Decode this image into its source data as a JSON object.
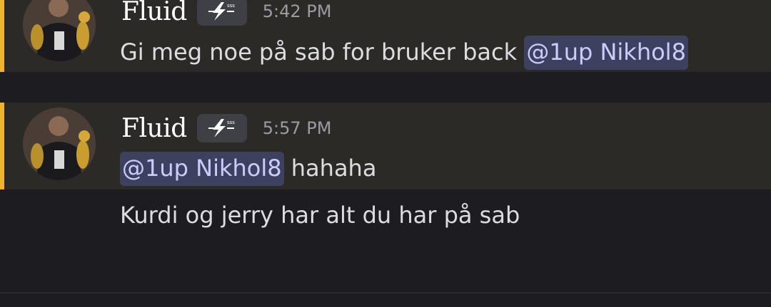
{
  "messages": [
    {
      "username": "Fluid",
      "timestamp": "5:42 PM",
      "badge_icon": "lightning-icon",
      "lines": [
        {
          "text": "Gi meg noe på sab for bruker back ",
          "mention": "@1up Nikhol8"
        }
      ]
    },
    {
      "username": "Fluid",
      "timestamp": "5:57 PM",
      "badge_icon": "lightning-icon",
      "lines": [
        {
          "mention": "@1up Nikhol8",
          "text": " hahaha"
        },
        {
          "text": "Kurdi og jerry har alt du har på sab"
        }
      ]
    }
  ],
  "colors": {
    "background": "#1c1c21",
    "highlight_bg": "#2c2a27",
    "highlight_bar": "#f0b232",
    "mention_bg": "#3e405f",
    "mention_text": "#c9cdfb",
    "timestamp": "#9a9ca3"
  }
}
